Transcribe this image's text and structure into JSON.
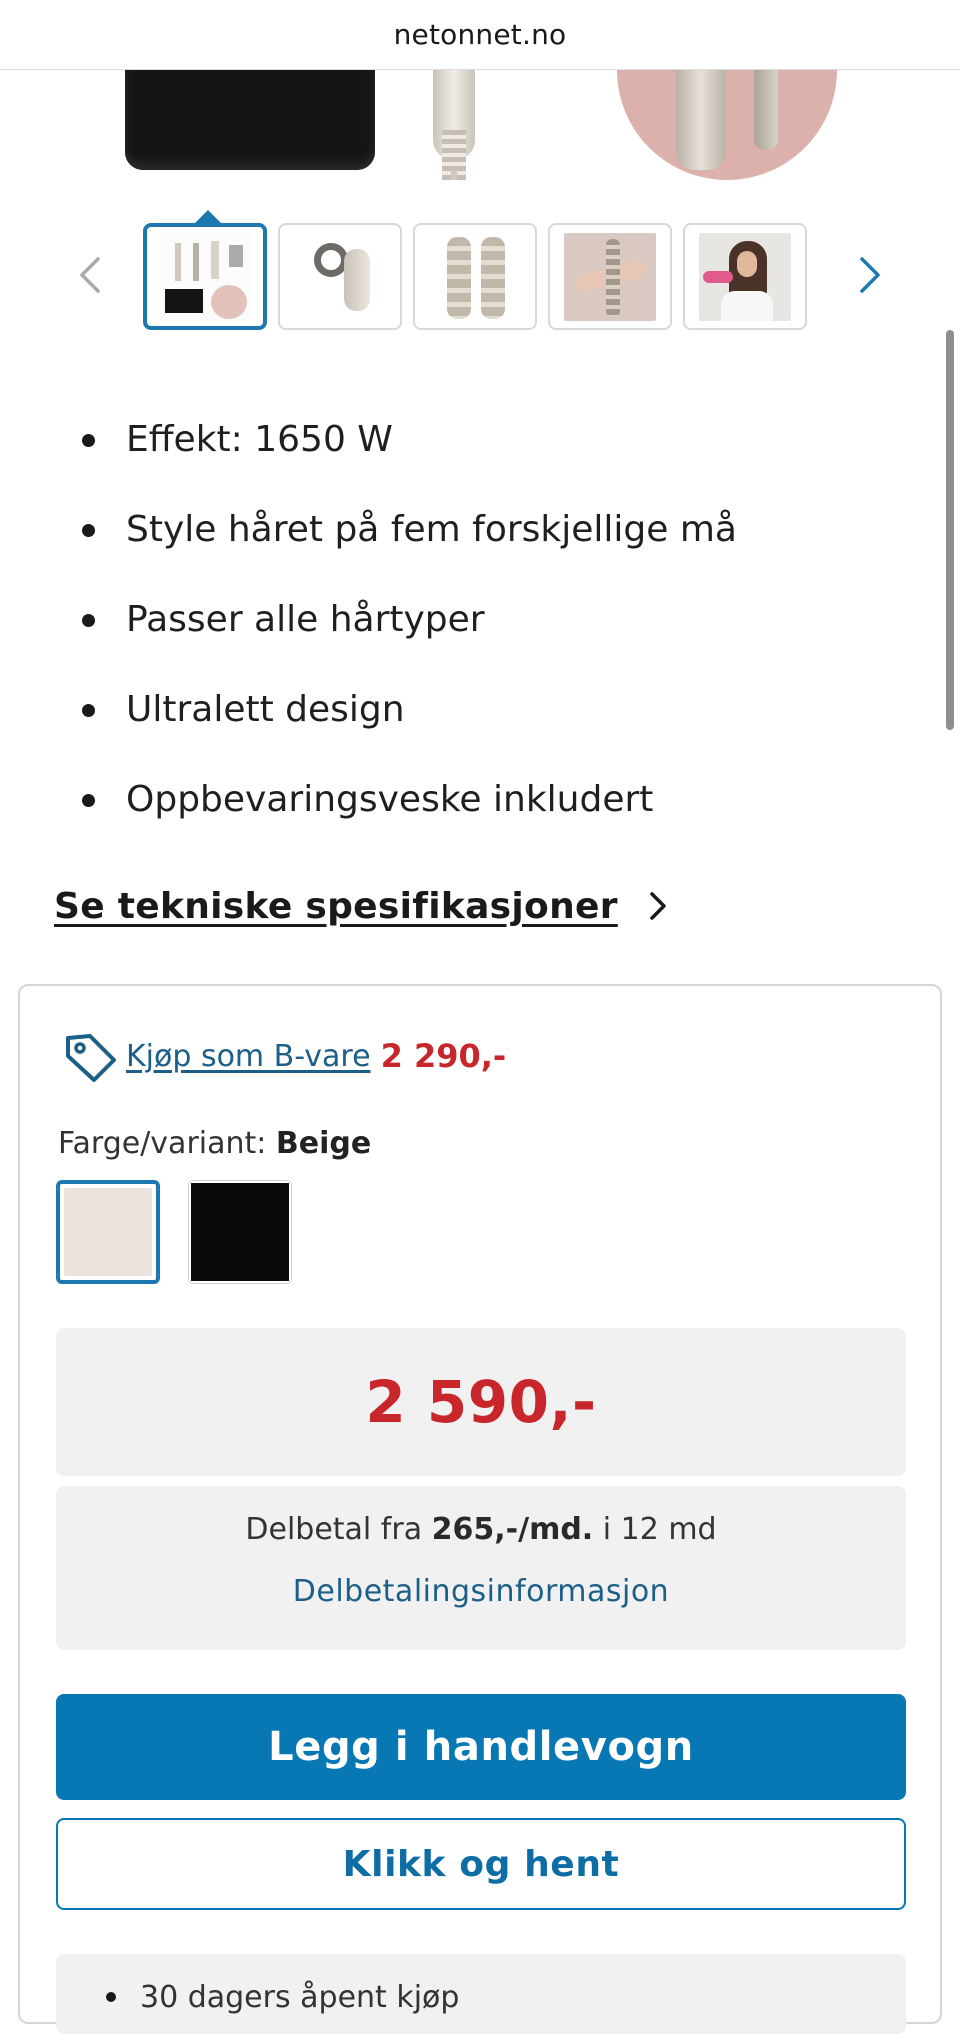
{
  "browser": {
    "url": "netonnet.no"
  },
  "gallery": {
    "thumbnails": [
      {
        "name": "product-set"
      },
      {
        "name": "dryer-head"
      },
      {
        "name": "curl-barrels"
      },
      {
        "name": "in-use-hand"
      },
      {
        "name": "model-photo"
      }
    ],
    "active_index": 0
  },
  "features": [
    "Effekt: 1650 W",
    "Style håret på fem forskjellige må",
    "Passer alle hårtyper",
    "Ultralett design",
    "Oppbevaringsveske inkludert"
  ],
  "spec_link": "Se tekniske spesifikasjoner",
  "bvare": {
    "link": "Kjøp som B-vare",
    "price": "2 290,-"
  },
  "variant": {
    "label": "Farge/variant:",
    "selected": "Beige",
    "options": [
      {
        "name": "Beige",
        "color": "#ece3dc"
      },
      {
        "name": "Svart",
        "color": "#0a0a0c"
      }
    ]
  },
  "price": "2 590,-",
  "installment": {
    "prefix": "Delbetal fra",
    "amount": "265,-/md.",
    "suffix": "i 12 md",
    "link": "Delbetalingsinformasjon"
  },
  "buttons": {
    "add_to_cart": "Legg i handlevogn",
    "click_collect": "Klikk og hent"
  },
  "next_info": "30 dagers åpent kjøp",
  "colors": {
    "accent": "#0778b3",
    "price_red": "#c9262c",
    "link_blue": "#1c5f88"
  }
}
